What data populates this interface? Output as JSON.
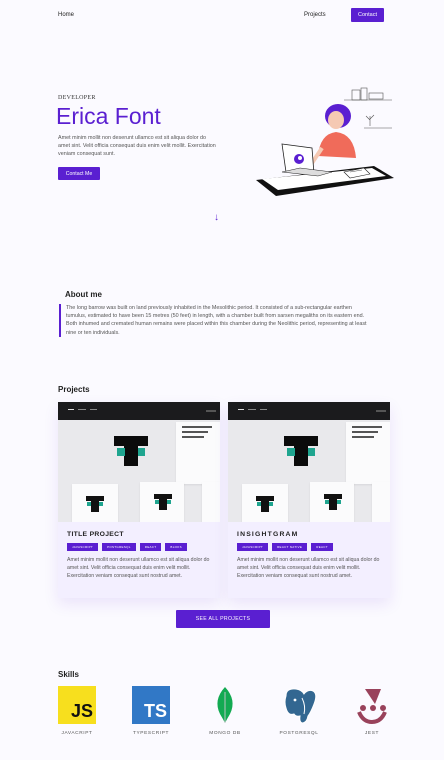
{
  "nav": {
    "home": "Home",
    "projects": "Projects",
    "contact": "Contact"
  },
  "hero": {
    "kicker": "DEVELOPER",
    "name": "Erica Font",
    "text": "Amet minim mollit non deserunt ullamco est sit aliqua dolor do amet sint. Velit officia consequat duis enim velit mollit. Exercitation veniam consequat sunt.",
    "button": "Contact Me",
    "scroll_icon": "arrow-down-icon"
  },
  "about": {
    "title": "About me",
    "body": "The long barrow was built on land previously inhabited in the Mesolithic period. It consisted of a sub-rectangular earthen tumulus, estimated to have been 15 metres (50 feet) in length, with a chamber built from sarsen megaliths on its eastern end. Both inhumed and cremated human remains were placed within this chamber during the Neolithic period, representing at least nine or ten individuals."
  },
  "projects": {
    "title": "Projects",
    "items": [
      {
        "title": "TITLE PROJECT",
        "tags": [
          "JAVASCRIPT",
          "POSTGRESQL",
          "REACT",
          "BLOKS"
        ],
        "text": "Amet minim mollit non deserunt ullamco est sit aliqua dolor do amet sint. Velit officia consequat duis enim velit mollit. Exercitation veniam consequat sunt nostrud amet."
      },
      {
        "title": "INSIGHTGRAM",
        "tags": [
          "JAVASCRIPT",
          "REACT NATIVE",
          "REACT"
        ],
        "text": "Amet minim mollit non deserunt ullamco est sit aliqua dolor do amet sint. Velit officia consequat duis enim velit mollit. Exercitation veniam consequat sunt nostrud amet."
      }
    ],
    "see_all": "SEE ALL PROJECTS"
  },
  "skills": {
    "title": "Skills",
    "items": [
      {
        "name": "JAVACRIPT",
        "logo_text": "JS",
        "icon": "javascript-icon"
      },
      {
        "name": "TYPESCRIPT",
        "logo_text": "TS",
        "icon": "typescript-icon"
      },
      {
        "name": "MONGO DB",
        "icon": "mongodb-icon"
      },
      {
        "name": "POSTGRESQL",
        "icon": "postgresql-icon"
      },
      {
        "name": "JEST",
        "icon": "jest-icon"
      }
    ]
  },
  "colors": {
    "accent": "#5a1fd1",
    "background": "#fbfaff",
    "card": "#f3efff"
  }
}
